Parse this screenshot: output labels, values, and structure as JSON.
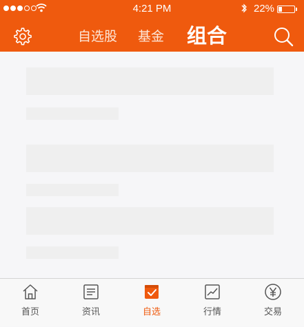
{
  "status_bar": {
    "time": "4:21 PM",
    "battery_percent_label": "22%",
    "battery_level": 0.22,
    "signal_bars_filled": 3,
    "signal_bars_total": 5
  },
  "header": {
    "tabs": [
      {
        "label": "自选股",
        "active": false
      },
      {
        "label": "基金",
        "active": false
      },
      {
        "label": "组合",
        "active": true
      }
    ],
    "left_icon": "gear-icon",
    "right_icon": "search-icon"
  },
  "colors": {
    "brand": "#ef5a0e",
    "page_background": "#f6f6f8",
    "skeleton": "#efefef",
    "tab_inactive_text": "#555555"
  },
  "tab_bar": {
    "items": [
      {
        "label": "首页",
        "icon": "home-icon",
        "active": false
      },
      {
        "label": "资讯",
        "icon": "news-icon",
        "active": false
      },
      {
        "label": "自选",
        "icon": "watchlist-checkbox-icon",
        "active": true
      },
      {
        "label": "行情",
        "icon": "market-chart-icon",
        "active": false
      },
      {
        "label": "交易",
        "icon": "yen-trade-icon",
        "active": false
      }
    ]
  }
}
